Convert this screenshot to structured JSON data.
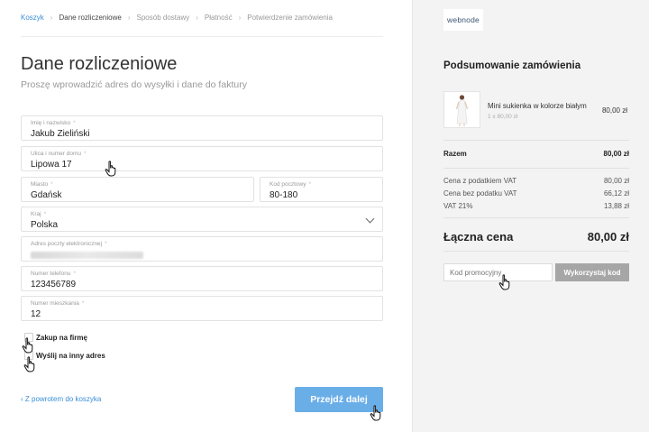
{
  "breadcrumb": [
    {
      "label": "Koszyk",
      "state": "link"
    },
    {
      "label": "Dane rozliczeniowe",
      "state": "active"
    },
    {
      "label": "Sposób dostawy",
      "state": "inactive"
    },
    {
      "label": "Płatność",
      "state": "inactive"
    },
    {
      "label": "Potwierdzenie zamówienia",
      "state": "inactive"
    }
  ],
  "breadcrumb_separator": "›",
  "page": {
    "title": "Dane rozliczeniowe",
    "subtitle": "Proszę wprowadzić adres do wysyłki i dane do faktury"
  },
  "form": {
    "required_mark": "*",
    "name": {
      "label": "Imię i nazwisko",
      "value": "Jakub Zieliński"
    },
    "street": {
      "label": "Ulica i numer domu",
      "value": "Lipowa 17"
    },
    "city": {
      "label": "Miasto",
      "value": "Gdańsk"
    },
    "postal": {
      "label": "Kod pocztowy",
      "value": "80-180"
    },
    "country": {
      "label": "Kraj",
      "value": "Polska"
    },
    "email": {
      "label": "Adres poczty elektronicznej",
      "value": ""
    },
    "phone": {
      "label": "Numer telefonu",
      "value": "123456789"
    },
    "apartment": {
      "label": "Numer mieszkania",
      "value": "12"
    },
    "company_purchase": "Zakup na firmę",
    "ship_other_address": "Wyślij na inny adres"
  },
  "actions": {
    "back": "‹  Z powrotem do koszyka",
    "next": "Przejdź dalej"
  },
  "sidebar": {
    "logo": "webnode",
    "summary_title": "Podsumowanie zamówienia",
    "product": {
      "name": "Mini sukienka w kolorze białym",
      "qty": "1 x 80,00 zł",
      "price": "80,00 zł"
    },
    "subtotal": {
      "label": "Razem",
      "value": "80,00 zł"
    },
    "tax_rows": [
      {
        "label": "Cena z podatkiem VAT",
        "value": "80,00 zł"
      },
      {
        "label": "Cena bez podatku VAT",
        "value": "66,12 zł"
      },
      {
        "label": "VAT 21%",
        "value": "13,88 zł"
      }
    ],
    "total": {
      "label": "Łączna cena",
      "value": "80,00 zł"
    },
    "promo_placeholder": "Kod promocyjny",
    "promo_button": "Wykorzystaj kod"
  },
  "colors": {
    "accent": "#3a8fd8",
    "primary_button": "#6aaee8",
    "secondary_button": "#a6a6a6",
    "sidebar_bg": "#f3f3f3"
  }
}
